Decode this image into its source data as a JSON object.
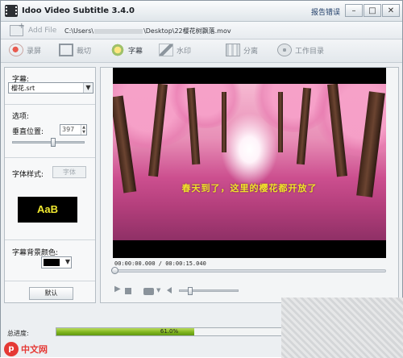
{
  "window": {
    "title": "Idoo Video Subtitle 3.4.0",
    "report_link": "报告错误"
  },
  "window_controls": {
    "minimize": "–",
    "maximize": "□",
    "close": "✕"
  },
  "file_bar": {
    "add_file_label": "Add File",
    "path_start": "C:\\Users\\",
    "path_end": "\\Desktop\\22樱花树飘落.mov"
  },
  "toolbar": {
    "items": [
      {
        "label": "录屏",
        "icon": "record-icon"
      },
      {
        "label": "裁切",
        "icon": "crop-icon"
      },
      {
        "label": "字幕",
        "icon": "subtitle-icon"
      },
      {
        "label": "水印",
        "icon": "watermark-icon"
      },
      {
        "label": "分离",
        "icon": "clip-icon"
      },
      {
        "label": "工作目录",
        "icon": "disc-icon"
      }
    ]
  },
  "left_panel": {
    "subtitle_label": "字幕:",
    "subtitle_file": "樱花.srt",
    "options_label": "选项:",
    "vertical_position_label": "垂直位置:",
    "vertical_position_value": "397",
    "vertical_position_level": 0.56,
    "font_style_label": "字体样式:",
    "font_button": "字体",
    "preview_text": "AaB",
    "bg_color_label": "字幕背景颜色:",
    "bg_color_value": "#000000",
    "default_button": "默认"
  },
  "video": {
    "subtitle_overlay": "春天到了，这里的樱花都开放了",
    "timecode": "00:00:00.000 / 00:00:15.040",
    "seek_position": 0.0,
    "volume_level": 0.15
  },
  "status": {
    "progress_label": "总进度:",
    "progress_percent": 61.0,
    "progress_text": "61.0%"
  },
  "watermark_logo": {
    "mark": "p",
    "text": "中文网"
  },
  "colors": {
    "progress_fill": "#7fb51e",
    "subtitle_text": "#f2e52a",
    "accent_red": "#e53935"
  }
}
